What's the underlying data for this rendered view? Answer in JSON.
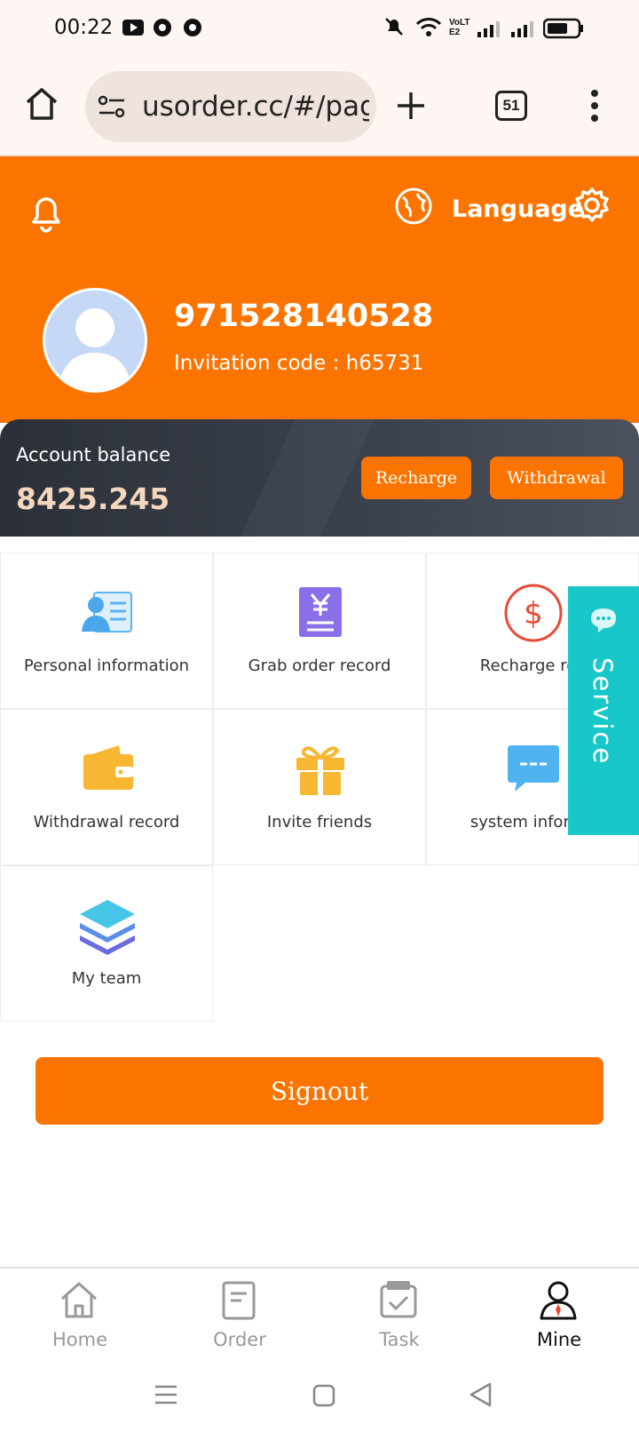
{
  "status_bar": {
    "time": "00:22",
    "network_label": "VoLTE2"
  },
  "browser": {
    "url": "usorder.cc/#/pag",
    "tab_count": "51"
  },
  "header": {
    "language_label": "Language",
    "username": "971528140528",
    "invitation_code": "Invitation code : h65731"
  },
  "balance": {
    "label": "Account balance",
    "value": "8425.245",
    "recharge_label": "Recharge",
    "withdrawal_label": "Withdrawal"
  },
  "menu": {
    "items": [
      {
        "label": "Personal information",
        "icon": "id-card-icon"
      },
      {
        "label": "Grab order record",
        "icon": "yen-document-icon"
      },
      {
        "label": "Recharge rec",
        "icon": "dollar-circle-icon"
      },
      {
        "label": "Withdrawal record",
        "icon": "wallet-icon"
      },
      {
        "label": "Invite friends",
        "icon": "gift-icon"
      },
      {
        "label": "system informa",
        "icon": "chat-bubble-icon"
      },
      {
        "label": "My team",
        "icon": "layers-icon"
      }
    ]
  },
  "service": {
    "label": "Service"
  },
  "signout_label": "Signout",
  "tabbar": {
    "items": [
      {
        "label": "Home"
      },
      {
        "label": "Order"
      },
      {
        "label": "Task"
      },
      {
        "label": "Mine"
      }
    ]
  },
  "colors": {
    "accent": "#fc7400",
    "service": "#18c8c8",
    "balance_value": "#f5d7bd"
  }
}
